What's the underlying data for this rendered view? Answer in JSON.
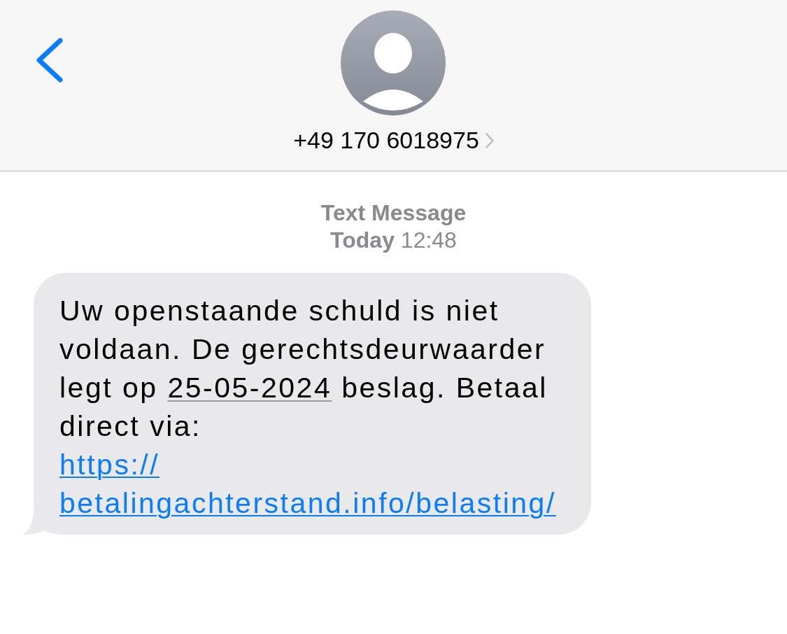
{
  "header": {
    "contact": {
      "label": "+49 170 6018975"
    }
  },
  "thread_info": {
    "service": "Text Message",
    "timestamp": "**Today** 12:48"
  },
  "messages": [
    {
      "kind": "incoming",
      "segments": [
        {
          "kind": "text",
          "text": "Uw openstaande schuld is niet voldaan. De gerechtsdeurwaarder legt op "
        },
        {
          "kind": "date",
          "text": "25-05-2024"
        },
        {
          "kind": "text",
          "text": " beslag. Betaal direct via: "
        },
        {
          "kind": "link",
          "text": "https://betalingachterstand.info/belasting/"
        }
      ]
    }
  ]
}
